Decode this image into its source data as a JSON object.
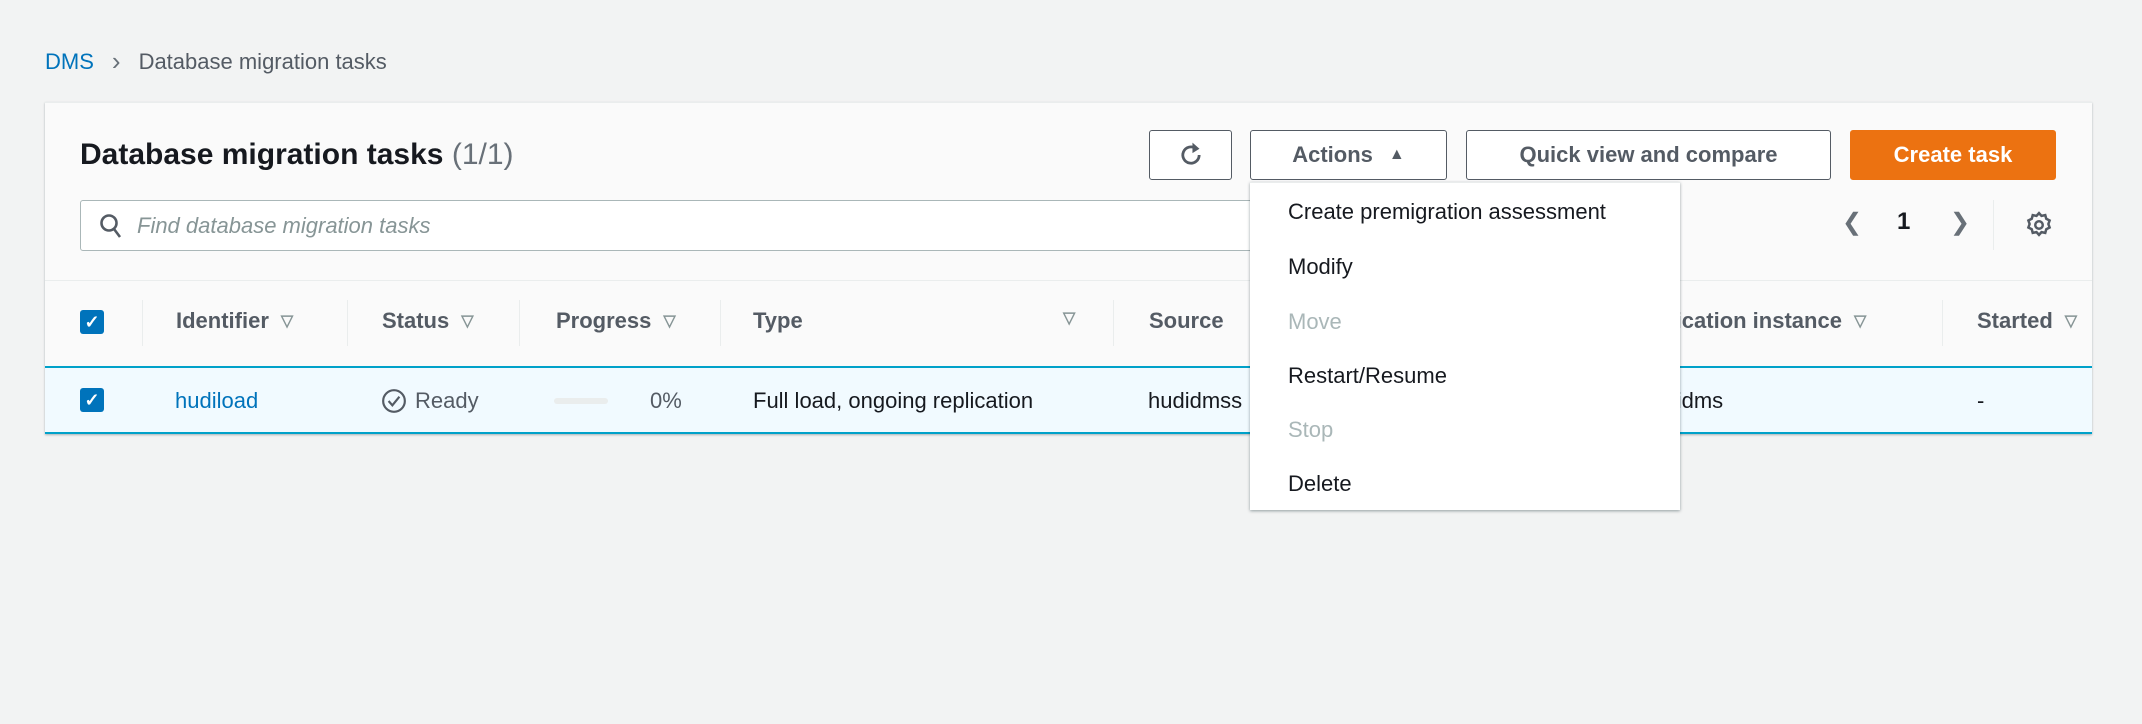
{
  "breadcrumb": {
    "root": "DMS",
    "current": "Database migration tasks"
  },
  "header": {
    "title": "Database migration tasks",
    "count": "(1/1)"
  },
  "toolbar": {
    "refresh_icon": "refresh-icon",
    "actions_label": "Actions",
    "quick_view_label": "Quick view and compare",
    "create_label": "Create task"
  },
  "search": {
    "placeholder": "Find database migration tasks",
    "value": ""
  },
  "pagination": {
    "page": "1"
  },
  "actions_menu": {
    "items": [
      {
        "label": "Create premigration assessment",
        "disabled": false
      },
      {
        "label": "Modify",
        "disabled": false
      },
      {
        "label": "Move",
        "disabled": true
      },
      {
        "label": "Restart/Resume",
        "disabled": false
      },
      {
        "label": "Stop",
        "disabled": true
      },
      {
        "label": "Delete",
        "disabled": false
      }
    ]
  },
  "table": {
    "columns": [
      "Identifier",
      "Status",
      "Progress",
      "Type",
      "Source",
      "Replication instance",
      "Started"
    ],
    "rows": [
      {
        "identifier": "hudiload",
        "status": "Ready",
        "progress": "0%",
        "progress_value": 0,
        "type": "Full load, ongoing replication",
        "source": "hudidmss",
        "replication_instance": "hudidms",
        "started": "-",
        "selected": true
      }
    ]
  },
  "colors": {
    "accent": "#ec7211",
    "link": "#0073bb",
    "selected_row": "#f1faff"
  }
}
